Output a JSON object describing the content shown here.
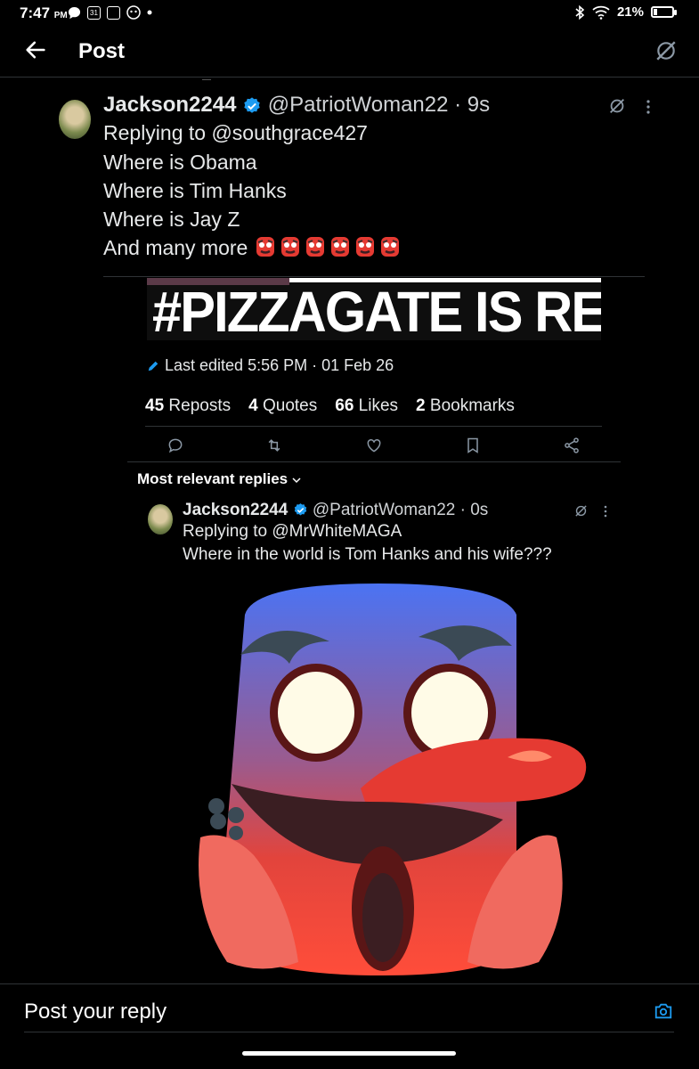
{
  "status_bar": {
    "time": "7:47",
    "ampm": "PM",
    "calendar_day": "31",
    "battery_percent": "21%",
    "battery_level": 0.21
  },
  "header": {
    "title": "Post"
  },
  "tweet": {
    "display_name": "Jackson2244",
    "handle_time": "@PatriotWoman22 · 9s",
    "replying_to": "Replying to @southgrace427",
    "lines": [
      "Where is Obama",
      "Where is Tim Hanks",
      "Where is Jay Z",
      "And many more"
    ],
    "emoji_name": "goblin-emoji",
    "emoji_count": 6,
    "quoted_image_text": "#PIZZAGATE IS REAL",
    "edited": "Last edited 5:56 PM · 01 Feb 26",
    "stats": [
      {
        "count": "45",
        "label": "Reposts"
      },
      {
        "count": "4",
        "label": "Quotes"
      },
      {
        "count": "66",
        "label": "Likes"
      },
      {
        "count": "2",
        "label": "Bookmarks"
      }
    ],
    "actions": [
      "reply-icon",
      "repost-icon",
      "like-icon",
      "bookmark-icon",
      "share-icon"
    ]
  },
  "replies_filter": "Most relevant replies",
  "reply": {
    "display_name": "Jackson2244",
    "handle_time": "@PatriotWoman22 · 0s",
    "replying_to": "Replying to @MrWhiteMAGA",
    "text": "Where in the world is Tom Hanks and his wife???",
    "image": "goblin-emoji"
  },
  "composer": {
    "placeholder": "Post your reply"
  },
  "colors": {
    "background": "#000000",
    "accent": "#1d9bf0",
    "divider": "#2f3336"
  }
}
